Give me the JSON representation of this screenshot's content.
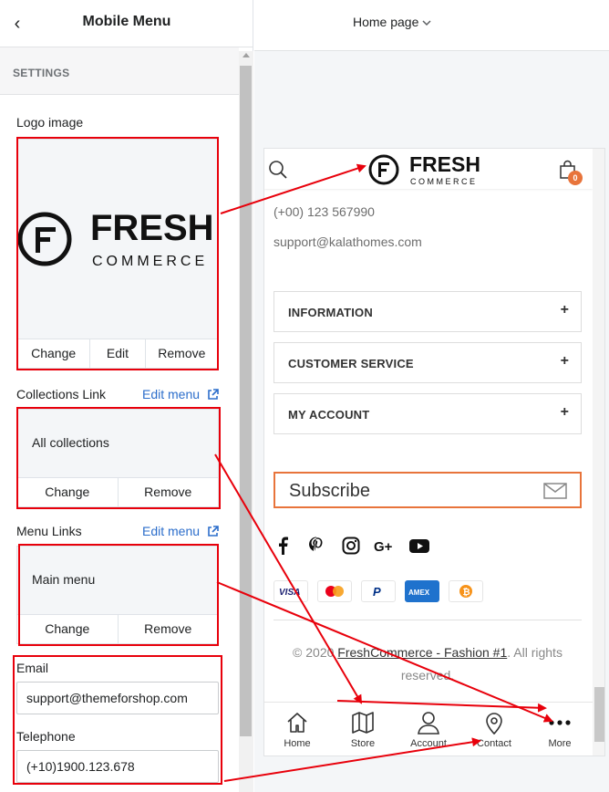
{
  "editor": {
    "title": "Mobile Menu",
    "settings_label": "SETTINGS",
    "logo": {
      "label": "Logo image",
      "change": "Change",
      "edit": "Edit",
      "remove": "Remove"
    },
    "collections": {
      "label": "Collections Link",
      "edit_menu": "Edit menu",
      "value": "All collections",
      "change": "Change",
      "remove": "Remove"
    },
    "menu_links": {
      "label": "Menu Links",
      "edit_menu": "Edit menu",
      "value": "Main menu",
      "change": "Change",
      "remove": "Remove"
    },
    "email": {
      "label": "Email",
      "value": "support@themeforshop.com"
    },
    "telephone": {
      "label": "Telephone",
      "value": "(+10)1900.123.678"
    }
  },
  "preview_header": {
    "page_select": "Home page"
  },
  "preview": {
    "logo": {
      "word": "FRESH",
      "sub": "COMMERCE"
    },
    "cart_count": "0",
    "phone": "(+00) 123 567990",
    "email": "support@kalathomes.com",
    "accordions": [
      "INFORMATION",
      "CUSTOMER SERVICE",
      "MY ACCOUNT"
    ],
    "accordion_toggle": "+",
    "subscribe_placeholder": "Subscribe",
    "copyright": {
      "prefix": "© 2020 ",
      "brand": "FreshCommerce - Fashion #1",
      "suffix": ". All rights reserved."
    },
    "payments": [
      "VISA",
      "MASTERCARD",
      "PAYPAL",
      "AMEX",
      "BITCOIN"
    ],
    "nav": [
      "Home",
      "Store",
      "Account",
      "Contact",
      "More"
    ]
  },
  "colors": {
    "annotation": "#e8000b",
    "link": "#2c6ecb",
    "accent": "#e8743b"
  }
}
